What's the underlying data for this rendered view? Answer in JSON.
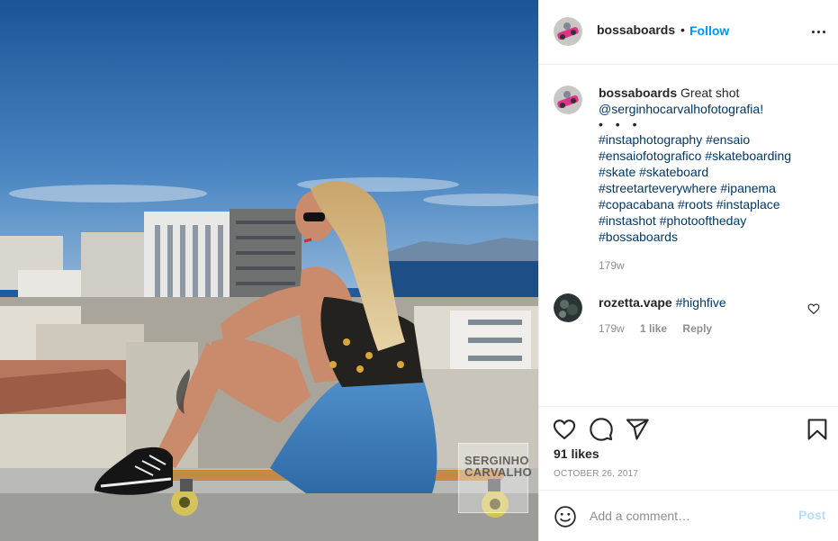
{
  "post": {
    "username": "bossaboards",
    "follow_label": "Follow",
    "separator": "•"
  },
  "photo": {
    "watermark_text": "SERGINHO\nCARVALHO"
  },
  "caption": {
    "username": "bossaboards",
    "text": "Great shot",
    "mention": "@serginhocarvalhofotografia!",
    "dots": "• • •",
    "hashtags": [
      "#instaphotography #ensaio",
      "#ensaiofotografico #skateboarding",
      "#skate #skateboard",
      "#streetarteverywhere #ipanema",
      "#copacabana #roots #instaplace",
      "#instashot #photooftheday",
      "#bossaboards"
    ],
    "time": "179w"
  },
  "reply": {
    "username": "rozetta.vape",
    "hashtag": "#highfive",
    "time": "179w",
    "likes_label": "1 like",
    "reply_label": "Reply"
  },
  "actions": {
    "likes_text": "91 likes",
    "date_text": "OCTOBER 26, 2017"
  },
  "comment_box": {
    "placeholder": "Add a comment…",
    "post_label": "Post"
  },
  "icons": [
    "more-icon",
    "heart-icon",
    "comment-icon",
    "share-icon",
    "bookmark-icon",
    "emoji-icon"
  ],
  "colors": {
    "link_blue": "#0095f6",
    "hashtag_blue": "#00376b",
    "muted_gray": "#8e8e8e",
    "post_disabled": "#b2dffc"
  }
}
